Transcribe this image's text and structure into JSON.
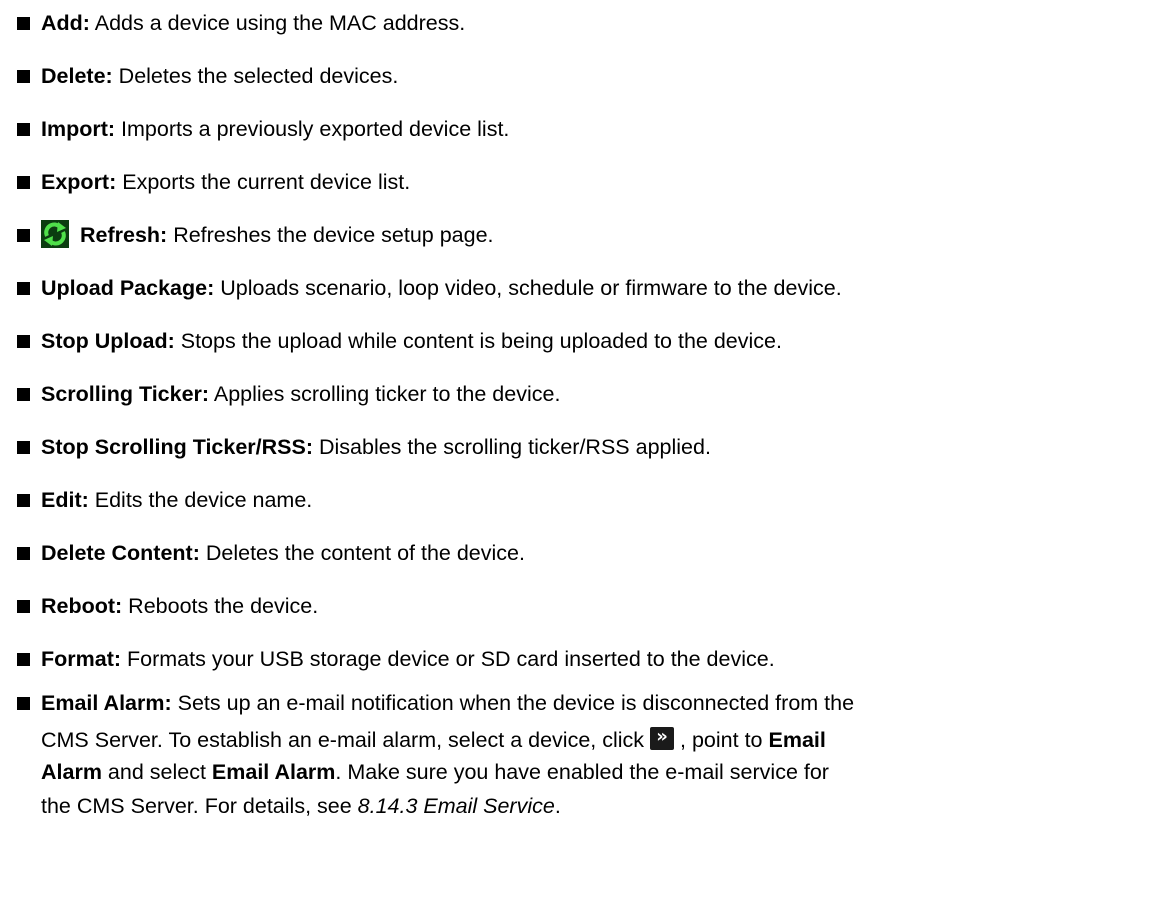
{
  "items": [
    {
      "term": "Add:",
      "desc": " Adds a device using the MAC address."
    },
    {
      "term": "Delete:",
      "desc": " Deletes the selected devices."
    },
    {
      "term": "Import:",
      "desc": " Imports a previously exported device list."
    },
    {
      "term": "Export:",
      "desc": " Exports the current device list."
    },
    {
      "term": "Refresh:",
      "desc": " Refreshes the device setup page.",
      "icon": "refresh-icon"
    },
    {
      "term": "Upload Package:",
      "desc": " Uploads scenario, loop video, schedule or firmware to the device."
    },
    {
      "term": "Stop Upload:",
      "desc": " Stops the upload while content is being uploaded to the device."
    },
    {
      "term": "Scrolling Ticker:",
      "desc": " Applies scrolling ticker to the device."
    },
    {
      "term": "Stop Scrolling Ticker/RSS:",
      "desc": " Disables the scrolling ticker/RSS applied."
    },
    {
      "term": "Edit:",
      "desc": " Edits the device name."
    },
    {
      "term": "Delete Content:",
      "desc": " Deletes the content of the device."
    },
    {
      "term": "Reboot:",
      "desc": " Reboots the device."
    },
    {
      "term": "Format:",
      "desc": " Formats your USB storage device or SD card inserted to the device."
    }
  ],
  "email_alarm": {
    "term": "Email Alarm:",
    "line1": " Sets up an e-mail notification when the device is disconnected from the",
    "line2_a": "CMS Server. To establish an e-mail alarm, select a device, click",
    "button_glyph": "»",
    "line2_b": ", point to ",
    "line2_bold": "Email",
    "line3_bold1": "Alarm",
    "line3_a": " and select ",
    "line3_bold2": "Email Alarm",
    "line3_b": ". Make sure you have enabled the e-mail service for",
    "line4_a": "the CMS Server. For details, see ",
    "line4_ref": "8.14.3 Email Service",
    "line4_b": "."
  }
}
